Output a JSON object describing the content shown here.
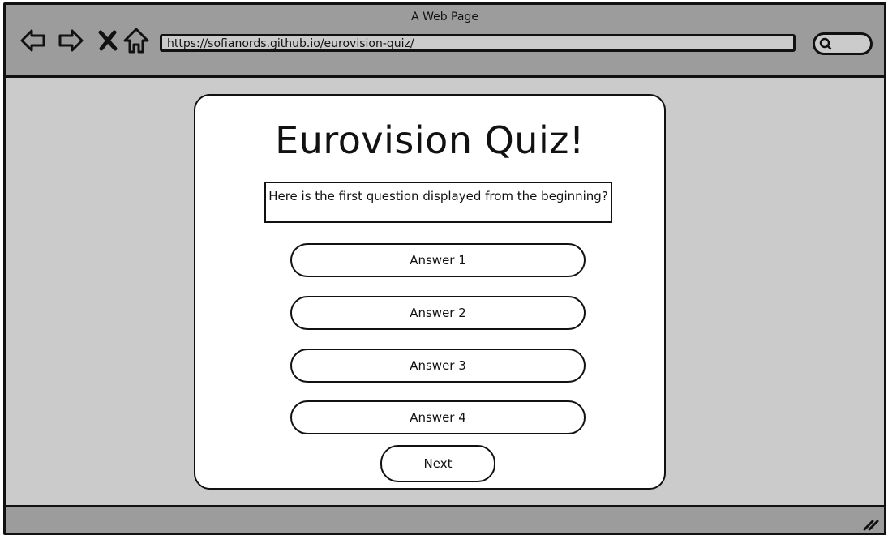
{
  "window": {
    "title": "A Web Page"
  },
  "toolbar": {
    "back_icon": "back-arrow-icon",
    "forward_icon": "forward-arrow-icon",
    "stop_icon": "close-icon",
    "home_icon": "home-icon",
    "url": "https://sofianords.github.io/eurovision-quiz/",
    "search_icon": "search-icon"
  },
  "quiz": {
    "title": "Eurovision Quiz!",
    "question": "Here is the first question displayed from the beginning?",
    "answers": [
      "Answer 1",
      "Answer 2",
      "Answer 3",
      "Answer 4"
    ],
    "next_label": "Next"
  },
  "colors": {
    "chrome": "#9c9c9c",
    "page_background": "#cbcbcb",
    "card": "#ffffff",
    "stroke": "#111111"
  }
}
